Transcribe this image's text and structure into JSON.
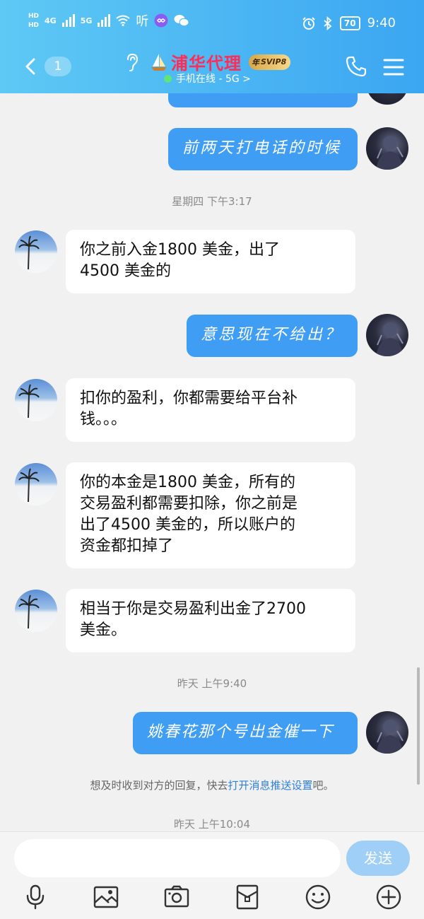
{
  "status_bar": {
    "hd_top": "HD",
    "hd_bottom": "HD",
    "net_1": "4G",
    "net_2": "5G",
    "extra": "听",
    "battery": "70",
    "time": "9:40"
  },
  "header": {
    "unread_count": "1",
    "title": "浦华代理",
    "svip_prefix": "年",
    "svip_label": "SVIP8",
    "online_status": "手机在线 - 5G >"
  },
  "messages": [
    {
      "side": "out",
      "text": "前两天打电话的时候"
    },
    {
      "type": "timestamp",
      "text": "星期四 下午3:17"
    },
    {
      "side": "in",
      "lines": [
        "你之前入金1800 美金，出了",
        "4500 美金的"
      ]
    },
    {
      "side": "out",
      "text": "意思现在不给出？"
    },
    {
      "side": "in",
      "lines": [
        "扣你的盈利，你都需要给平台补",
        "钱。。。"
      ]
    },
    {
      "side": "in",
      "lines": [
        "你的本金是1800 美金，所有的",
        "交易盈利都需要扣除，你之前是",
        "出了4500 美金的，所以账户的",
        "资金都扣掉了"
      ]
    },
    {
      "side": "in",
      "lines": [
        "相当于你是交易盈利出金了2700",
        "美金。"
      ]
    },
    {
      "type": "timestamp",
      "text": "昨天 上午9:40"
    },
    {
      "side": "out",
      "text": "姚春花那个号出金催一下"
    },
    {
      "type": "notice",
      "before": "想及时收到对方的回复，快去",
      "link": "打开消息推送设置",
      "after": "吧。"
    },
    {
      "type": "timestamp",
      "text": "昨天 上午10:04"
    }
  ],
  "input": {
    "placeholder": "",
    "send_label": "发送"
  },
  "toolbar": [
    "microphone-icon",
    "image-icon",
    "camera-icon",
    "red-packet-icon",
    "emoji-icon",
    "plus-icon"
  ],
  "colors": {
    "header_start": "#5ec9f4",
    "header_end": "#3ba6f2",
    "outgoing_bubble": "#3f9df3",
    "incoming_bubble": "#ffffff",
    "title": "#ff2d55",
    "send_button": "#9fcff6"
  }
}
